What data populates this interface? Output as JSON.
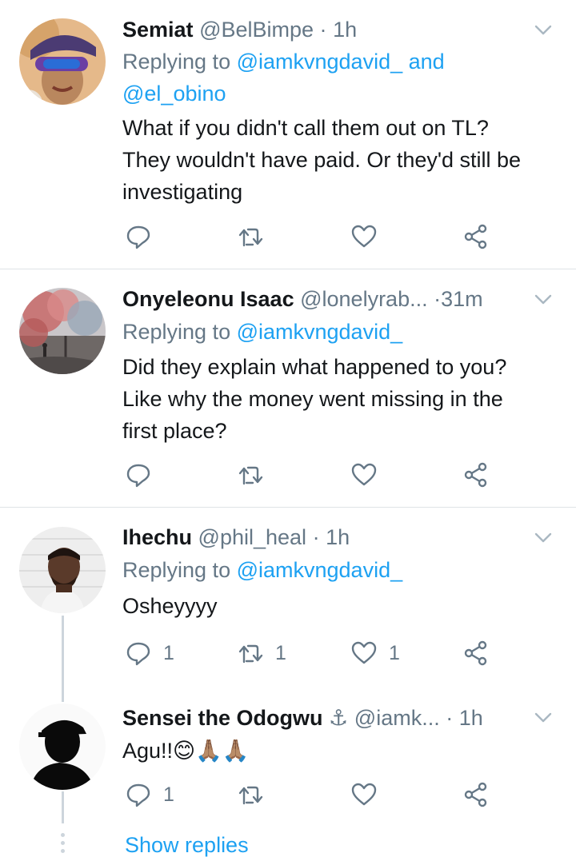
{
  "tweets": [
    {
      "name": "Semiat",
      "handle": "@BelBimpe",
      "dot": "·",
      "time": "1h",
      "replying_prefix": "Replying to ",
      "replying_mentions": "@iamkvngdavid_ and",
      "replying_mentions_line2": "@el_obino",
      "text_lines": [
        "What if you didn't call them out on TL?",
        "They wouldn't have paid. Or they'd still be",
        "investigating"
      ],
      "reply_count": "",
      "retweet_count": "",
      "like_count": ""
    },
    {
      "name": "Onyeleonu Isaac",
      "handle": "@lonelyrab...",
      "dot": "·",
      "time": "31m",
      "replying_prefix": "Replying to ",
      "replying_mentions": "@iamkvngdavid_",
      "text_lines": [
        "Did they explain what happened to you?",
        "Like why the money went missing in the",
        "first place?"
      ],
      "reply_count": "",
      "retweet_count": "",
      "like_count": ""
    },
    {
      "name": "Ihechu",
      "handle": "@phil_heal",
      "dot": "·",
      "time": "1h",
      "replying_prefix": "Replying to ",
      "replying_mentions": "@iamkvngdavid_",
      "text_lines": [
        "Osheyyyy"
      ],
      "reply_count": "1",
      "retweet_count": "1",
      "like_count": "1"
    },
    {
      "name": "Sensei the Odogwu",
      "name_emoji": "⚓",
      "handle": "@iamk...",
      "dot": "·",
      "time": "1h",
      "text": "Agu!!",
      "text_emoji": "😊🙏🏽🙏🏽",
      "reply_count": "1",
      "retweet_count": "",
      "like_count": ""
    }
  ],
  "show_replies": "Show replies",
  "colors": {
    "accent": "#1da1f2",
    "secondary_text": "#657786",
    "primary_text": "#14171a",
    "divider": "#dfe3e6",
    "thread_line": "#cdd5dc"
  },
  "icons": {
    "reply": "reply-icon",
    "retweet": "retweet-icon",
    "like": "like-icon",
    "share": "share-icon",
    "caret": "chevron-down-icon",
    "anchor": "anchor-icon"
  }
}
